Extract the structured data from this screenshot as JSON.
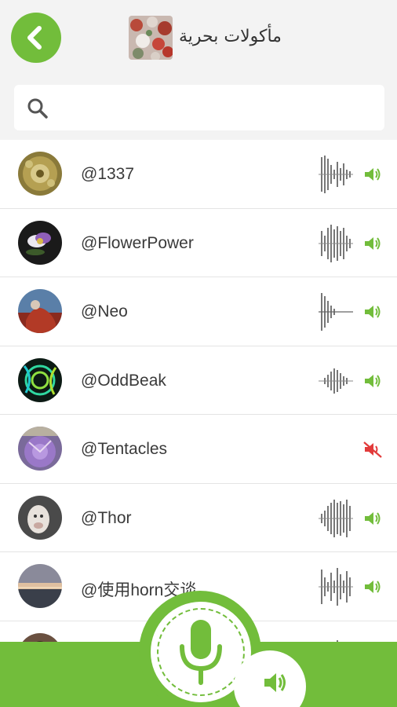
{
  "header": {
    "title": "مأكولات بحرية",
    "back_icon": "chevron-left-icon",
    "thumb_alt": "group photo"
  },
  "search": {
    "placeholder": "",
    "value": "",
    "icon": "search-icon"
  },
  "colors": {
    "accent": "#72bd3b",
    "muted": "#e23b3b",
    "header_bg": "#f3f3f3"
  },
  "members": [
    {
      "name": "@1337",
      "has_audio": true,
      "muted": false
    },
    {
      "name": "@FlowerPower",
      "has_audio": true,
      "muted": false
    },
    {
      "name": "@Neo",
      "has_audio": true,
      "muted": false
    },
    {
      "name": "@OddBeak",
      "has_audio": true,
      "muted": false
    },
    {
      "name": "@Tentacles",
      "has_audio": false,
      "muted": true
    },
    {
      "name": "@Thor",
      "has_audio": true,
      "muted": false
    },
    {
      "name": "@使用horn交谈",
      "has_audio": true,
      "muted": false
    }
  ],
  "controls": {
    "mic_icon": "microphone-icon",
    "speaker_icon": "speaker-icon"
  }
}
